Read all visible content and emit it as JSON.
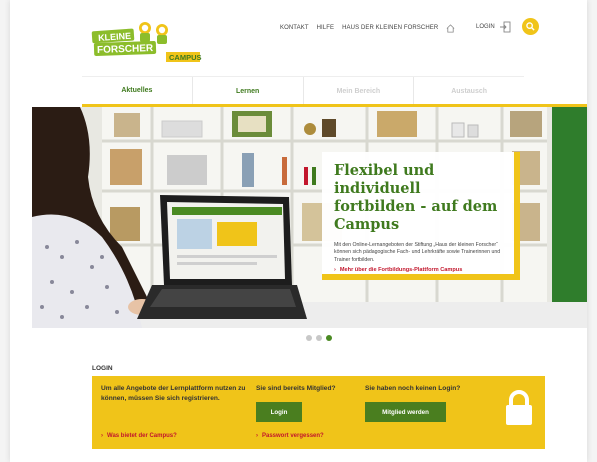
{
  "logo": {
    "line1": "KLEINE",
    "line2": "FORSCHER",
    "badge": "CAMPUS"
  },
  "topnav": {
    "kontakt": "KONTAKT",
    "hilfe": "HILFE",
    "haus": "HAUS DER KLEINEN FORSCHER",
    "login": "LOGIN"
  },
  "mainnav": [
    {
      "label": "Aktuelles",
      "state": "active"
    },
    {
      "label": "Lernen",
      "state": "normal"
    },
    {
      "label": "Mein Bereich",
      "state": "disabled"
    },
    {
      "label": "Austausch",
      "state": "disabled"
    }
  ],
  "hero": {
    "title": "Flexibel und individuell fortbilden - auf dem Campus",
    "text": "Mit den Online-Lernangeboten der Stiftung „Haus der kleinen Forscher“ können sich pädagogische Fach- und Lehrkräfte sowie Trainerinnen und Trainer fortbilden.",
    "link": "Mehr über die Fortbildungs-Plattform Campus"
  },
  "carousel": {
    "count": 3,
    "active": 3
  },
  "login_section": {
    "heading": "LOGIN",
    "intro": "Um alle Angebote der Lernplattform nutzen zu können, müssen Sie sich registrieren.",
    "member_q": "Sie sind bereits Mitglied?",
    "nologin_q": "Sie haben noch keinen Login?",
    "login_btn": "Login",
    "register_btn": "Mitglied werden",
    "campus_link": "Was bietet der Campus?",
    "forgot_link": "Passwort vergessen?"
  },
  "colors": {
    "yellow": "#f0c419",
    "green": "#4a7e1f",
    "red": "#c2162c",
    "title_green": "#3f7a1e"
  },
  "icons": {
    "home": "home-icon",
    "login": "login-door-icon",
    "search": "search-icon",
    "lock": "lock-icon",
    "arrow": "chevron-right-icon"
  }
}
